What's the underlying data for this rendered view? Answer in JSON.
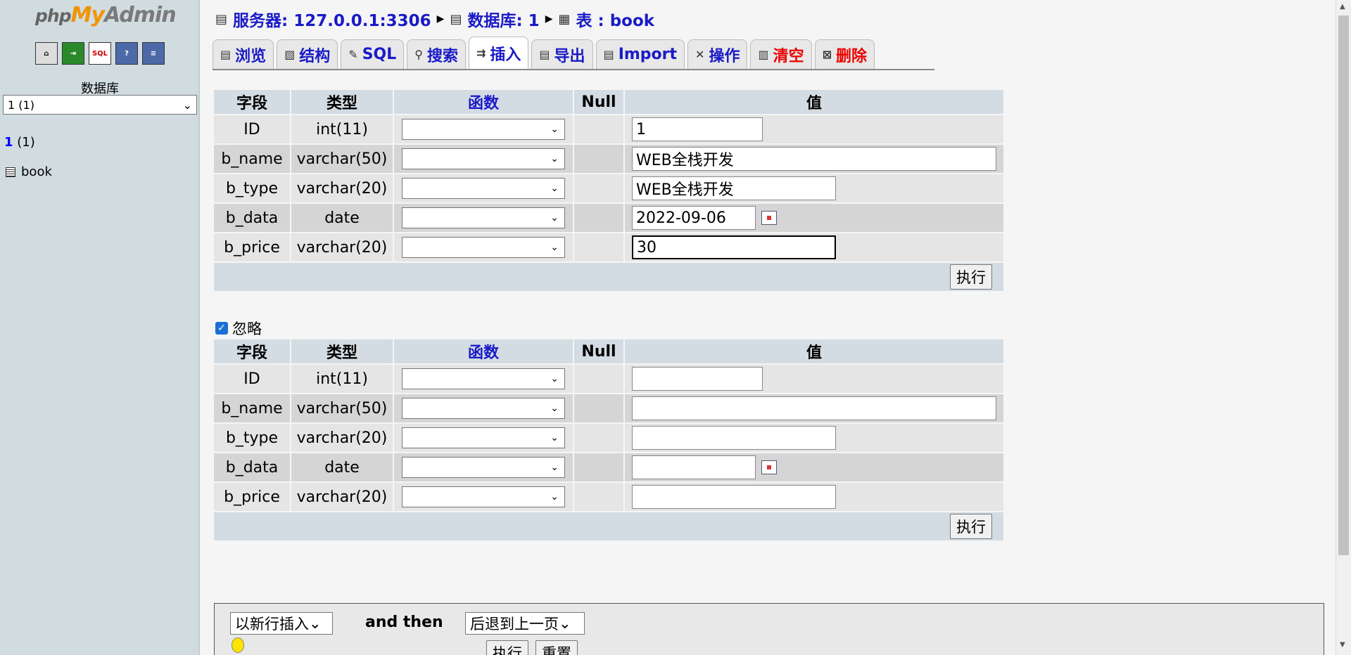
{
  "app": {
    "logo_php": "php",
    "logo_my": "My",
    "logo_admin": "Admin"
  },
  "sidebar": {
    "icons": [
      "home-icon",
      "export-icon",
      "sql-icon",
      "help-icon",
      "sql-query-icon"
    ],
    "db_label": "数据库",
    "db_select": "1 (1)",
    "db_link_name": "1",
    "db_link_count": "(1)",
    "table": "book"
  },
  "breadcrumb": {
    "server": "服务器: 127.0.0.1:3306",
    "database": "数据库: 1",
    "table": "表 : book"
  },
  "tabs": [
    {
      "label": "浏览",
      "icon": "browse-icon"
    },
    {
      "label": "结构",
      "icon": "structure-icon"
    },
    {
      "label": "SQL",
      "icon": "sql-icon"
    },
    {
      "label": "搜索",
      "icon": "search-icon"
    },
    {
      "label": "插入",
      "icon": "insert-icon",
      "active": true
    },
    {
      "label": "导出",
      "icon": "export-icon"
    },
    {
      "label": "Import",
      "icon": "import-icon"
    },
    {
      "label": "操作",
      "icon": "operations-icon"
    },
    {
      "label": "清空",
      "icon": "empty-icon",
      "danger": true
    },
    {
      "label": "删除",
      "icon": "drop-icon",
      "danger": true
    }
  ],
  "columns": {
    "field": "字段",
    "type": "类型",
    "function": "函数",
    "null": "Null",
    "value": "值"
  },
  "rows1": [
    {
      "field": "ID",
      "type": "int(11)",
      "value": "1"
    },
    {
      "field": "b_name",
      "type": "varchar(50)",
      "value": "WEB全栈开发"
    },
    {
      "field": "b_type",
      "type": "varchar(20)",
      "value": "WEB全栈开发"
    },
    {
      "field": "b_data",
      "type": "date",
      "value": "2022-09-06"
    },
    {
      "field": "b_price",
      "type": "varchar(20)",
      "value": "30"
    }
  ],
  "rows2": [
    {
      "field": "ID",
      "type": "int(11)",
      "value": ""
    },
    {
      "field": "b_name",
      "type": "varchar(50)",
      "value": ""
    },
    {
      "field": "b_type",
      "type": "varchar(20)",
      "value": ""
    },
    {
      "field": "b_data",
      "type": "date",
      "value": ""
    },
    {
      "field": "b_price",
      "type": "varchar(20)",
      "value": ""
    }
  ],
  "execute_label": "执行",
  "ignore_label": "忽略",
  "bottom": {
    "insert_mode": "以新行插入",
    "and_then": "and then",
    "after": "后退到上一页",
    "go": "执行",
    "reset": "重置"
  }
}
